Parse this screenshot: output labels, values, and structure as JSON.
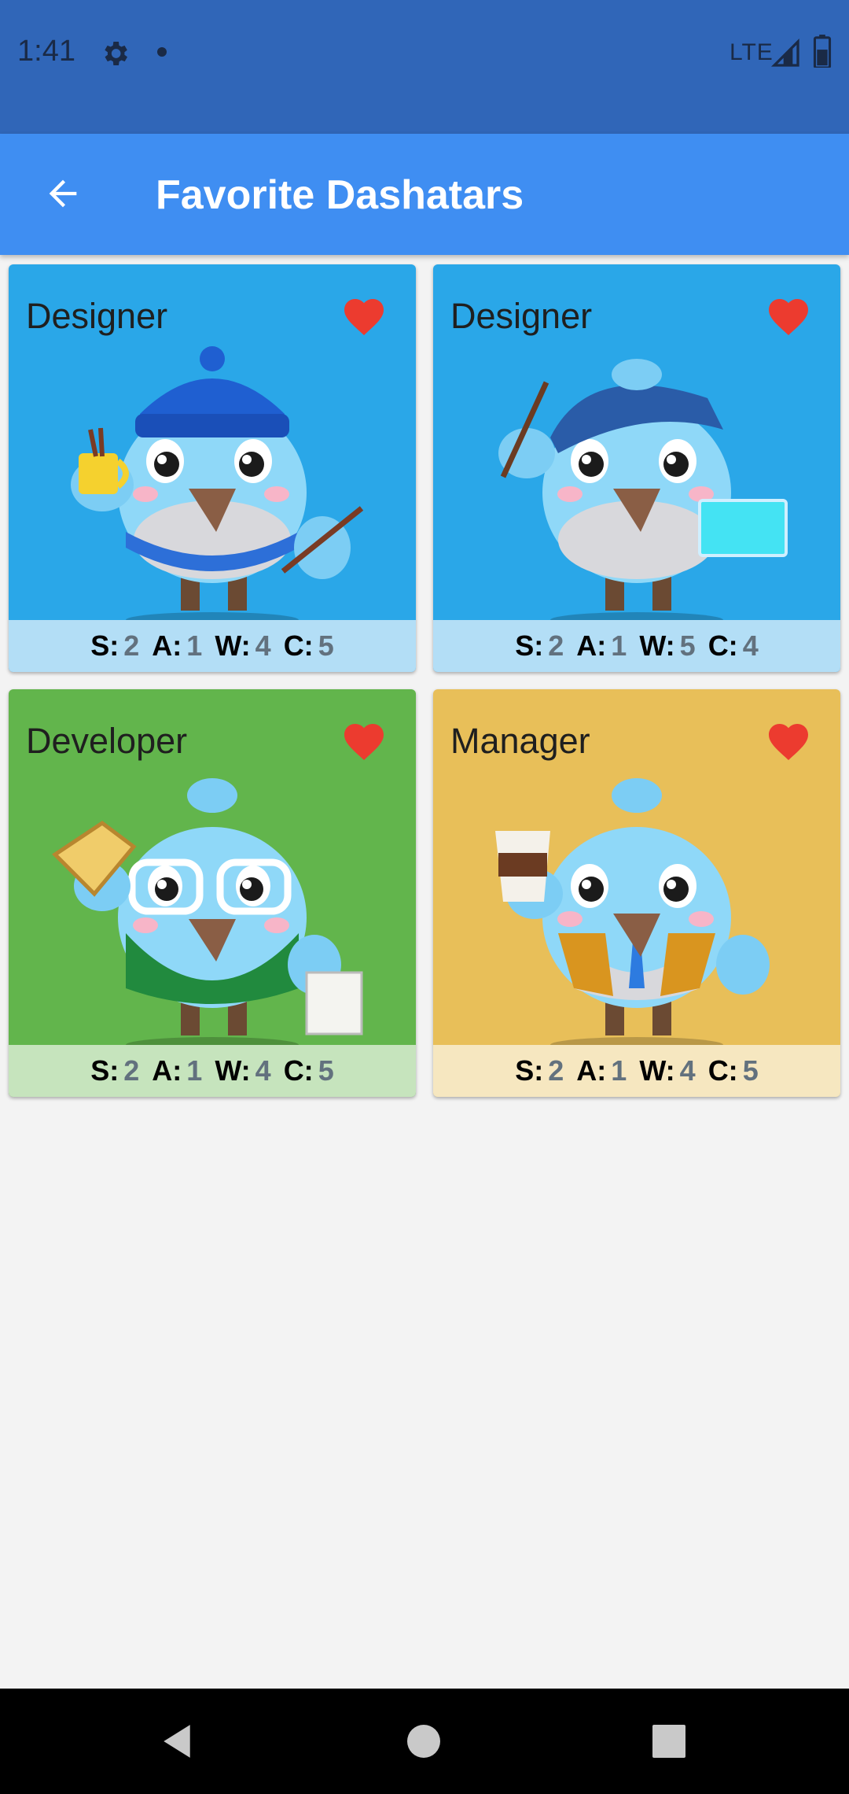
{
  "status_bar": {
    "time": "1:41",
    "network": "LTE"
  },
  "app_bar": {
    "title": "Favorite Dashatars"
  },
  "stat_labels": {
    "s": "S:",
    "a": "A:",
    "w": "W:",
    "c": "C:"
  },
  "cards": [
    {
      "title": "Designer",
      "s": "2",
      "a": "1",
      "w": "4",
      "c": "5",
      "bg": "#2aa7e8",
      "footer": "#b3def6",
      "accessory": "mug",
      "hat": "beanie"
    },
    {
      "title": "Designer",
      "s": "2",
      "a": "1",
      "w": "5",
      "c": "4",
      "bg": "#2aa7e8",
      "footer": "#b3def6",
      "accessory": "laptop",
      "hat": "beret"
    },
    {
      "title": "Developer",
      "s": "2",
      "a": "1",
      "w": "4",
      "c": "5",
      "bg": "#62b54c",
      "footer": "#c6e4bd",
      "accessory": "sandwich",
      "hat": "glasses"
    },
    {
      "title": "Manager",
      "s": "2",
      "a": "1",
      "w": "4",
      "c": "5",
      "bg": "#e8bf59",
      "footer": "#f6e7c0",
      "accessory": "coffee-cup",
      "hat": "vest"
    }
  ],
  "colors": {
    "status_bar": "#3066b8",
    "app_bar": "#3f8ef2",
    "heart": "#ec3b2f",
    "background": "#f3f3f3"
  }
}
